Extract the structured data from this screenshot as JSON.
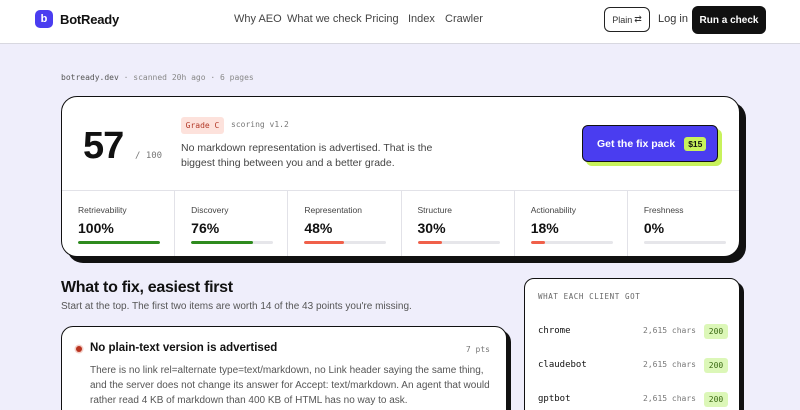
{
  "nav": {
    "logo_letter": "b",
    "brand": "BotReady",
    "links": [
      "Why AEO",
      "What we check",
      "Pricing",
      "Index",
      "Crawler"
    ],
    "plain_label": "Plain",
    "login_label": "Log in",
    "run_label": "Run a check"
  },
  "scan": {
    "domain": "botready.dev",
    "sep": "·",
    "scanned": "scanned 20h ago",
    "pages": "6 pages"
  },
  "score": {
    "value": "57",
    "max": "/ 100",
    "grade": "Grade C",
    "version": "scoring v1.2",
    "summary": "No markdown representation is advertised. That is the biggest thing between you and a better grade.",
    "fix_label": "Get the fix pack",
    "fix_price": "$15"
  },
  "colors": {
    "good": "#2e8b1e",
    "bad": "#f0604a",
    "accent": "#4a3df0",
    "lime": "#c8f25c"
  },
  "metrics": [
    {
      "label": "Retrievability",
      "value": "100%",
      "percent": 100,
      "status": "good"
    },
    {
      "label": "Discovery",
      "value": "76%",
      "percent": 76,
      "status": "good"
    },
    {
      "label": "Representation",
      "value": "48%",
      "percent": 48,
      "status": "bad"
    },
    {
      "label": "Structure",
      "value": "30%",
      "percent": 30,
      "status": "bad"
    },
    {
      "label": "Actionability",
      "value": "18%",
      "percent": 18,
      "status": "bad"
    },
    {
      "label": "Freshness",
      "value": "0%",
      "percent": 0,
      "status": "bad"
    }
  ],
  "fix": {
    "title": "What to fix, easiest first",
    "subtitle": "Start at the top. The first two items are worth 14 of the 43 points you're missing.",
    "issue": {
      "title": "No plain-text version is advertised",
      "points": "7 pts",
      "body": "There is no link rel=alternate type=text/markdown, no Link header saying the same thing, and the server does not change its answer for Accept: text/markdown. An agent that would rather read 4 KB of markdown than 400 KB of HTML has no way to ask."
    }
  },
  "clients": {
    "heading": "WHAT EACH CLIENT GOT",
    "rows": [
      {
        "name": "chrome",
        "size": "2,615 chars",
        "code": "200"
      },
      {
        "name": "claudebot",
        "size": "2,615 chars",
        "code": "200"
      },
      {
        "name": "gptbot",
        "size": "2,615 chars",
        "code": "200"
      }
    ]
  }
}
